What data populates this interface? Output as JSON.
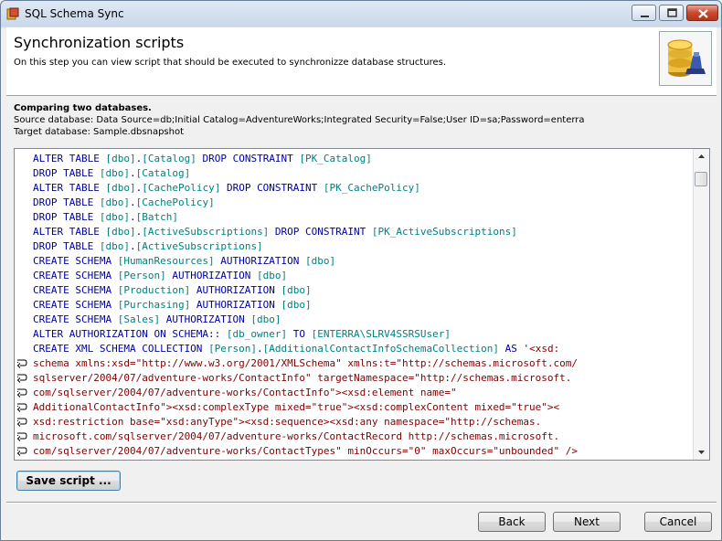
{
  "window": {
    "title": "SQL Schema Sync"
  },
  "header": {
    "title": "Synchronization scripts",
    "subtitle": "On this step you can view script that should be executed to synchronizze database structures."
  },
  "info": {
    "heading": "Comparing two databases.",
    "source": "Source database: Data Source=db;Initial Catalog=AdventureWorks;Integrated Security=False;User ID=sa;Password=enterra",
    "target": "Target database: Sample.dbsnapshot"
  },
  "script_lines": [
    [
      [
        "kw",
        "ALTER TABLE "
      ],
      [
        "id",
        "[dbo]"
      ],
      [
        "kw",
        "."
      ],
      [
        "id",
        "[Catalog]"
      ],
      [
        "kw",
        " DROP CONSTRAINT "
      ],
      [
        "id",
        "[PK_Catalog]"
      ]
    ],
    [
      [
        "kw",
        "DROP TABLE "
      ],
      [
        "id",
        "[dbo]"
      ],
      [
        "kw",
        "."
      ],
      [
        "id",
        "[Catalog]"
      ]
    ],
    [
      [
        "kw",
        "ALTER TABLE "
      ],
      [
        "id",
        "[dbo]"
      ],
      [
        "kw",
        "."
      ],
      [
        "id",
        "[CachePolicy]"
      ],
      [
        "kw",
        " DROP CONSTRAINT "
      ],
      [
        "id",
        "[PK_CachePolicy]"
      ]
    ],
    [
      [
        "kw",
        "DROP TABLE "
      ],
      [
        "id",
        "[dbo]"
      ],
      [
        "kw",
        "."
      ],
      [
        "id",
        "[CachePolicy]"
      ]
    ],
    [
      [
        "kw",
        "DROP TABLE "
      ],
      [
        "id",
        "[dbo]"
      ],
      [
        "kw",
        "."
      ],
      [
        "id",
        "[Batch]"
      ]
    ],
    [
      [
        "kw",
        "ALTER TABLE "
      ],
      [
        "id",
        "[dbo]"
      ],
      [
        "kw",
        "."
      ],
      [
        "id",
        "[ActiveSubscriptions]"
      ],
      [
        "kw",
        " DROP CONSTRAINT "
      ],
      [
        "id",
        "[PK_ActiveSubscriptions]"
      ]
    ],
    [
      [
        "kw",
        "DROP TABLE "
      ],
      [
        "id",
        "[dbo]"
      ],
      [
        "kw",
        "."
      ],
      [
        "id",
        "[ActiveSubscriptions]"
      ]
    ],
    [
      [
        "kw",
        "CREATE SCHEMA "
      ],
      [
        "id",
        "[HumanResources]"
      ],
      [
        "kw",
        " AUTHORIZATION "
      ],
      [
        "id",
        "[dbo]"
      ]
    ],
    [
      [
        "kw",
        "CREATE SCHEMA "
      ],
      [
        "id",
        "[Person]"
      ],
      [
        "kw",
        " AUTHORIZATION "
      ],
      [
        "id",
        "[dbo]"
      ]
    ],
    [
      [
        "kw",
        "CREATE SCHEMA "
      ],
      [
        "id",
        "[Production]"
      ],
      [
        "kw",
        " AUTHORIZATION "
      ],
      [
        "id",
        "[dbo]"
      ]
    ],
    [
      [
        "kw",
        "CREATE SCHEMA "
      ],
      [
        "id",
        "[Purchasing]"
      ],
      [
        "kw",
        " AUTHORIZATION "
      ],
      [
        "id",
        "[dbo]"
      ]
    ],
    [
      [
        "kw",
        "CREATE SCHEMA "
      ],
      [
        "id",
        "[Sales]"
      ],
      [
        "kw",
        " AUTHORIZATION "
      ],
      [
        "id",
        "[dbo]"
      ]
    ],
    [
      [
        "kw",
        "ALTER AUTHORIZATION ON SCHEMA:: "
      ],
      [
        "id",
        "[db_owner]"
      ],
      [
        "kw",
        " TO "
      ],
      [
        "id",
        "[ENTERRA\\SLRV4SSRSUser]"
      ]
    ],
    [
      [
        "kw",
        "CREATE XML SCHEMA COLLECTION "
      ],
      [
        "id",
        "[Person]"
      ],
      [
        "kw",
        "."
      ],
      [
        "id",
        "[AdditionalContactInfoSchemaCollection]"
      ],
      [
        "kw",
        " AS "
      ],
      [
        "str",
        "'<xsd:"
      ]
    ],
    [
      [
        "str",
        "schema xmlns:xsd=\"http://www.w3.org/2001/XMLSchema\" xmlns:t=\"http://schemas.microsoft.com/"
      ]
    ],
    [
      [
        "str",
        "sqlserver/2004/07/adventure-works/ContactInfo\" targetNamespace=\"http://schemas.microsoft."
      ]
    ],
    [
      [
        "str",
        "com/sqlserver/2004/07/adventure-works/ContactInfo\"><xsd:element name=\""
      ]
    ],
    [
      [
        "str",
        "AdditionalContactInfo\"><xsd:complexType mixed=\"true\"><xsd:complexContent mixed=\"true\"><"
      ]
    ],
    [
      [
        "str",
        "xsd:restriction base=\"xsd:anyType\"><xsd:sequence><xsd:any namespace=\"http://schemas."
      ]
    ],
    [
      [
        "str",
        "microsoft.com/sqlserver/2004/07/adventure-works/ContactRecord http://schemas.microsoft."
      ]
    ],
    [
      [
        "str",
        "com/sqlserver/2004/07/adventure-works/ContactTypes\" minOccurs=\"0\" maxOccurs=\"unbounded\" />"
      ]
    ]
  ],
  "wrapped_line_indices": [
    14,
    15,
    16,
    17,
    18,
    19,
    20
  ],
  "buttons": {
    "save": "Save script ...",
    "back": "Back",
    "next": "Next",
    "cancel": "Cancel"
  }
}
